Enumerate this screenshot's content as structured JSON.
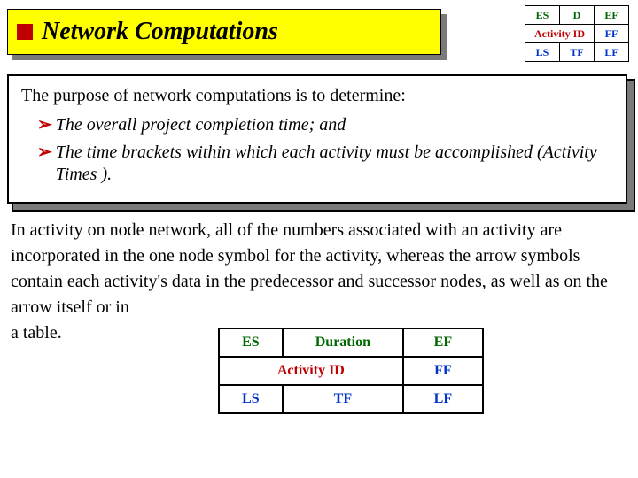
{
  "title": "Network Computations",
  "mini_table": {
    "r1": {
      "c1": "ES",
      "c2": "D",
      "c3": "EF"
    },
    "r2": {
      "c12": "Activity ID",
      "c3": "FF"
    },
    "r3": {
      "c1": "LS",
      "c2": "TF",
      "c3": "LF"
    }
  },
  "purpose_intro": "The purpose of network computations is to determine:",
  "bullets": {
    "b1": "The overall project completion time; and",
    "b2": "The time brackets within which each activity must be accomplished (Activity Times )."
  },
  "paragraph_part1": "In activity on node network, all of the numbers associated with an activity are incorporated in the one node symbol for the activity, whereas the arrow symbols contain each activity's data in the predecessor and successor nodes, as well as on the arrow itself or in",
  "paragraph_last_line_prefix": "a table.",
  "big_table": {
    "r1": {
      "c1": "ES",
      "c2": "Duration",
      "c3": "EF"
    },
    "r2": {
      "c12": "Activity ID",
      "c3": "FF"
    },
    "r3": {
      "c1": "LS",
      "c2": "TF",
      "c3": "LF"
    }
  }
}
